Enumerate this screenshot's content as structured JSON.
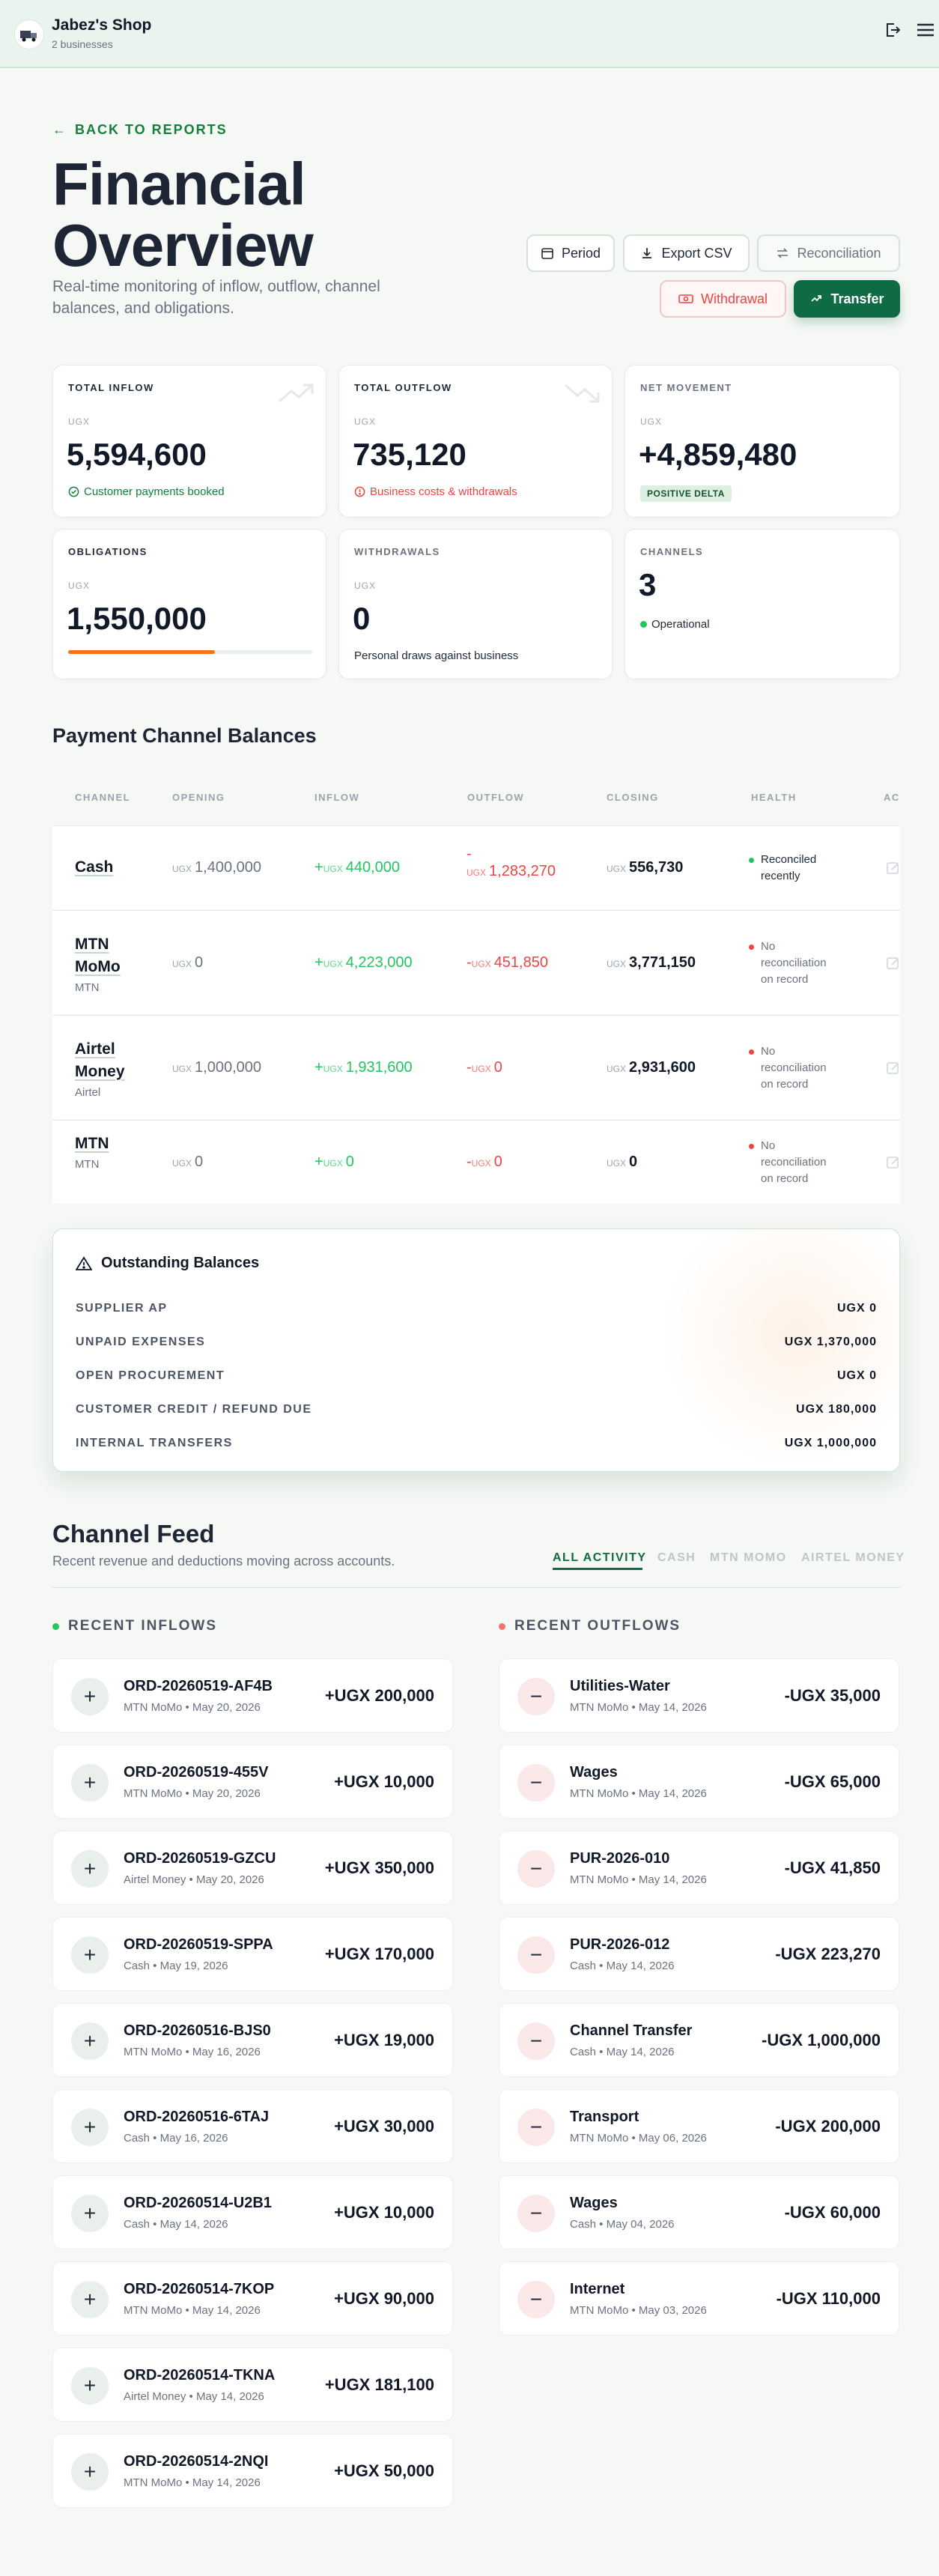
{
  "header": {
    "shop_name": "Jabez's Shop",
    "business_count": "2 businesses"
  },
  "back_link": "BACK TO REPORTS",
  "page": {
    "title": "Financial Overview",
    "subtitle": "Real-time monitoring of inflow, outflow, channel balances, and obligations."
  },
  "actions": {
    "period": "Period",
    "export": "Export CSV",
    "reconciliation": "Reconciliation",
    "withdrawal": "Withdrawal",
    "transfer": "Transfer"
  },
  "stats": {
    "total_inflow": {
      "label": "TOTAL INFLOW",
      "unit": "UGX",
      "value": "5,594,600",
      "note": "Customer payments booked"
    },
    "total_outflow": {
      "label": "TOTAL OUTFLOW",
      "unit": "UGX",
      "value": "735,120",
      "note": "Business costs & withdrawals"
    },
    "net_movement": {
      "label": "NET MOVEMENT",
      "unit": "UGX",
      "value": "+4,859,480",
      "badge": "POSITIVE DELTA"
    },
    "obligations": {
      "label": "OBLIGATIONS",
      "unit": "UGX",
      "value": "1,550,000",
      "progress": 0.6
    },
    "withdrawals": {
      "label": "WITHDRAWALS",
      "unit": "UGX",
      "value": "0",
      "note": "Personal draws against business"
    },
    "channels": {
      "label": "CHANNELS",
      "value": "3",
      "note": "Operational"
    }
  },
  "channels_section": {
    "title": "Payment Channel Balances",
    "columns": [
      "CHANNEL",
      "OPENING",
      "INFLOW",
      "OUTFLOW",
      "CLOSING",
      "HEALTH",
      "AC"
    ],
    "currency": "UGX",
    "rows": [
      {
        "name": "Cash",
        "sub": "",
        "opening": "1,400,000",
        "inflow": "440,000",
        "outflow": "1,283,270",
        "closing": "556,730",
        "health": "Reconciled recently",
        "health_color": "#22c55e"
      },
      {
        "name": "MTN MoMo",
        "sub": "MTN",
        "opening": "0",
        "inflow": "4,223,000",
        "outflow": "451,850",
        "closing": "3,771,150",
        "health": "No reconciliation on record",
        "health_color": "#ef4444"
      },
      {
        "name": "Airtel Money",
        "sub": "Airtel",
        "opening": "1,000,000",
        "inflow": "1,931,600",
        "outflow": "0",
        "closing": "2,931,600",
        "health": "No reconciliation on record",
        "health_color": "#ef4444"
      },
      {
        "name": "MTN",
        "sub": "MTN",
        "opening": "0",
        "inflow": "0",
        "outflow": "0",
        "closing": "0",
        "health": "No reconciliation on record",
        "health_color": "#ef4444"
      }
    ]
  },
  "outstanding": {
    "title": "Outstanding Balances",
    "rows": [
      {
        "label": "SUPPLIER AP",
        "value": "UGX 0"
      },
      {
        "label": "UNPAID EXPENSES",
        "value": "UGX 1,370,000"
      },
      {
        "label": "OPEN PROCUREMENT",
        "value": "UGX 0"
      },
      {
        "label": "CUSTOMER CREDIT / REFUND DUE",
        "value": "UGX 180,000"
      },
      {
        "label": "INTERNAL TRANSFERS",
        "value": "UGX 1,000,000"
      }
    ]
  },
  "feed": {
    "title": "Channel Feed",
    "subtitle": "Recent revenue and deductions moving across accounts.",
    "tabs": [
      "ALL ACTIVITY",
      "CASH",
      "MTN MOMO",
      "AIRTEL MONEY"
    ],
    "inflows_label": "RECENT INFLOWS",
    "outflows_label": "RECENT OUTFLOWS",
    "inflows": [
      {
        "title": "ORD-20260519-AF4B",
        "sub": "MTN MoMo • May 20, 2026",
        "amount": "+UGX 200,000"
      },
      {
        "title": "ORD-20260519-455V",
        "sub": "MTN MoMo • May 20, 2026",
        "amount": "+UGX 10,000"
      },
      {
        "title": "ORD-20260519-GZCU",
        "sub": "Airtel Money • May 20, 2026",
        "amount": "+UGX 350,000"
      },
      {
        "title": "ORD-20260519-SPPA",
        "sub": "Cash • May 19, 2026",
        "amount": "+UGX 170,000"
      },
      {
        "title": "ORD-20260516-BJS0",
        "sub": "MTN MoMo • May 16, 2026",
        "amount": "+UGX 19,000"
      },
      {
        "title": "ORD-20260516-6TAJ",
        "sub": "Cash • May 16, 2026",
        "amount": "+UGX 30,000"
      },
      {
        "title": "ORD-20260514-U2B1",
        "sub": "Cash • May 14, 2026",
        "amount": "+UGX 10,000"
      },
      {
        "title": "ORD-20260514-7KOP",
        "sub": "MTN MoMo • May 14, 2026",
        "amount": "+UGX 90,000"
      },
      {
        "title": "ORD-20260514-TKNA",
        "sub": "Airtel Money • May 14, 2026",
        "amount": "+UGX 181,100"
      },
      {
        "title": "ORD-20260514-2NQI",
        "sub": "MTN MoMo • May 14, 2026",
        "amount": "+UGX 50,000"
      }
    ],
    "outflows": [
      {
        "title": "Utilities-Water",
        "sub": "MTN MoMo • May 14, 2026",
        "amount": "-UGX 35,000"
      },
      {
        "title": "Wages",
        "sub": "MTN MoMo • May 14, 2026",
        "amount": "-UGX 65,000"
      },
      {
        "title": "PUR-2026-010",
        "sub": "MTN MoMo • May 14, 2026",
        "amount": "-UGX 41,850"
      },
      {
        "title": "PUR-2026-012",
        "sub": "Cash • May 14, 2026",
        "amount": "-UGX 223,270"
      },
      {
        "title": "Channel Transfer",
        "sub": "Cash • May 14, 2026",
        "amount": "-UGX 1,000,000"
      },
      {
        "title": "Transport",
        "sub": "MTN MoMo • May 06, 2026",
        "amount": "-UGX 200,000"
      },
      {
        "title": "Wages",
        "sub": "Cash • May 04, 2026",
        "amount": "-UGX 60,000"
      },
      {
        "title": "Internet",
        "sub": "MTN MoMo • May 03, 2026",
        "amount": "-UGX 110,000"
      }
    ]
  },
  "colors": {
    "accent": "#0f6b43",
    "positive": "#22c55e",
    "negative": "#ef4444",
    "obligation_bar": "#f97316"
  }
}
